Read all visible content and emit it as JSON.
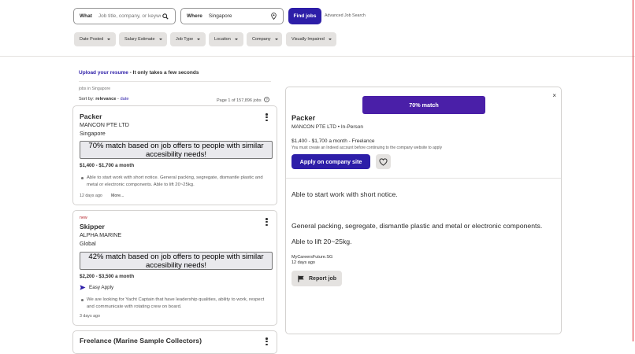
{
  "search": {
    "what_label": "What",
    "what_placeholder": "Job title, company, or keywords",
    "where_label": "Where",
    "where_value": "Singapore",
    "find_label": "Find jobs",
    "advanced_label": "Advanced Job Search"
  },
  "filters": [
    "Date Posted",
    "Salary Estimate",
    "Job Type",
    "Location",
    "Company",
    "Visually Impaired"
  ],
  "upload": {
    "link": "Upload your resume",
    "rest": " - It only takes a few seconds"
  },
  "jobs_in": "jobs in Singapore",
  "sort": {
    "prefix": "Sort by: ",
    "active": "relevance",
    "sep": " - ",
    "other": "date"
  },
  "page_info": "Page 1 of 157,896 jobs",
  "jobs": [
    {
      "title": "Packer",
      "company": "MANCON PTE LTD",
      "location": "Singapore",
      "match_text": "70% match based on job offers to people with similar accesibility needs!",
      "salary": "$1,400 - $1,700 a month",
      "snippet": "Able to start work with short notice. General packing, segregate, dismantle plastic and metal or electronic components. Able to lift 20~25kg.",
      "date": "12 days ago",
      "more": "More..."
    },
    {
      "new": "new",
      "title": "Skipper",
      "company": "ALPHA MARINE",
      "location": "Global",
      "match_text": "42% match based on job offers to people with similar accesibility needs!",
      "salary": "$2,200 - $3,500 a month",
      "easy_apply": "Easy Apply",
      "snippet": "We are looking for Yacht Captain that have leadership qualities, ability to work, respect and communicate with rotating crew on board.",
      "date": "3 days ago"
    },
    {
      "title": "Freelance (Marine Sample Collectors)"
    }
  ],
  "detail": {
    "match": "70% match",
    "close": "×",
    "title": "Packer",
    "company_line": "MANCON PTE LTD  •  In-Person",
    "salary_line": "$1,400 - $1,700 a month  -  Freelance",
    "note": "You must create an Indeed account before continuing to the company website to apply",
    "apply": "Apply on company site",
    "body1": "Able to start work with short notice.",
    "body2": "General packing, segregate, dismantle plastic and metal or electronic components.",
    "body3": "Able to lift 20~25kg.",
    "source": "MyCareersFuture.SG",
    "posted": "12 days ago",
    "report": "Report job"
  },
  "colors": {
    "primary": "#2d1ea8",
    "match_purple": "#4a1fa8",
    "new_red": "#b7282e"
  }
}
